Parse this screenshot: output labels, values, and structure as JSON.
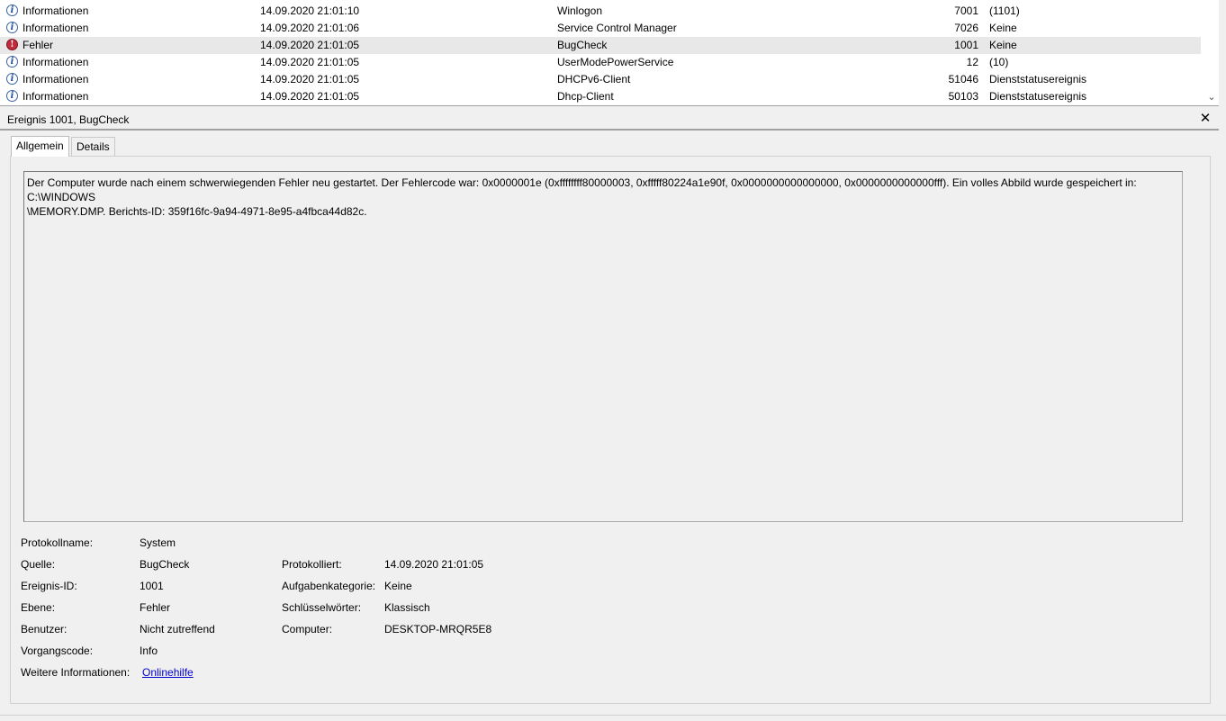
{
  "event_list": {
    "rows": [
      {
        "level": "Informationen",
        "level_type": "info",
        "date": "14.09.2020 21:01:10",
        "source": "Winlogon",
        "event_id": "7001",
        "task": "(1101)"
      },
      {
        "level": "Informationen",
        "level_type": "info",
        "date": "14.09.2020 21:01:06",
        "source": "Service Control Manager",
        "event_id": "7026",
        "task": "Keine"
      },
      {
        "level": "Fehler",
        "level_type": "error",
        "date": "14.09.2020 21:01:05",
        "source": "BugCheck",
        "event_id": "1001",
        "task": "Keine",
        "selected": true
      },
      {
        "level": "Informationen",
        "level_type": "info",
        "date": "14.09.2020 21:01:05",
        "source": "UserModePowerService",
        "event_id": "12",
        "task": "(10)"
      },
      {
        "level": "Informationen",
        "level_type": "info",
        "date": "14.09.2020 21:01:05",
        "source": "DHCPv6-Client",
        "event_id": "51046",
        "task": "Dienststatusereignis"
      },
      {
        "level": "Informationen",
        "level_type": "info",
        "date": "14.09.2020 21:01:05",
        "source": "Dhcp-Client",
        "event_id": "50103",
        "task": "Dienststatusereignis"
      }
    ],
    "icons": {
      "info": "i",
      "error": "!",
      "scroll_down": "⌄"
    }
  },
  "detail": {
    "title": "Ereignis 1001, BugCheck",
    "close_glyph": "✕",
    "tabs": [
      {
        "label": "Allgemein",
        "active": true
      },
      {
        "label": "Details",
        "active": false
      }
    ],
    "description": "Der Computer wurde nach einem schwerwiegenden Fehler neu gestartet. Der Fehlercode war: 0x0000001e (0xffffffff80000003, 0xfffff80224a1e90f, 0x0000000000000000, 0x0000000000000fff). Ein volles Abbild wurde gespeichert in: C:\\WINDOWS\n\\MEMORY.DMP. Berichts-ID: 359f16fc-9a94-4971-8e95-a4fbca44d82c.",
    "properties": {
      "log_name": {
        "label": "Protokollname:",
        "value": "System"
      },
      "source": {
        "label": "Quelle:",
        "value": "BugCheck"
      },
      "logged": {
        "label": "Protokolliert:",
        "value": "14.09.2020 21:01:05"
      },
      "event_id": {
        "label": "Ereignis-ID:",
        "value": "1001"
      },
      "task_category": {
        "label": "Aufgabenkategorie:",
        "value": "Keine"
      },
      "level": {
        "label": "Ebene:",
        "value": "Fehler"
      },
      "keywords": {
        "label": "Schlüsselwörter:",
        "value": "Klassisch"
      },
      "user": {
        "label": "Benutzer:",
        "value": "Nicht zutreffend"
      },
      "computer": {
        "label": "Computer:",
        "value": "DESKTOP-MRQR5E8"
      },
      "opcode": {
        "label": "Vorgangscode:",
        "value": "Info"
      },
      "more_info": {
        "label": "Weitere Informationen:",
        "link": "Onlinehilfe"
      }
    }
  }
}
